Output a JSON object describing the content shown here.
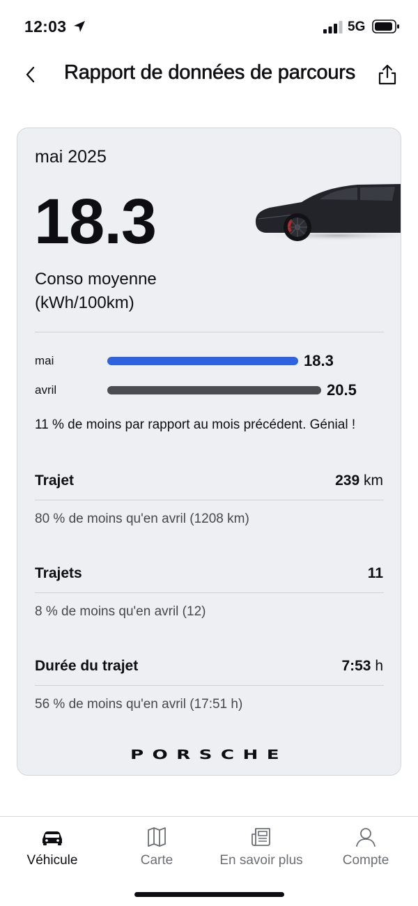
{
  "status_bar": {
    "time": "12:03",
    "location_icon": "location-arrow-icon",
    "signal_icon": "signal-bars-icon",
    "network": "5G",
    "battery_icon": "battery-icon"
  },
  "header": {
    "back_icon": "chevron-left-icon",
    "title": "Rapport de données de parcours",
    "share_icon": "share-icon"
  },
  "report": {
    "month": "mai 2025",
    "average_value": "18.3",
    "average_label_line1": "Conso moyenne",
    "average_label_line2": "(kWh/100km)",
    "comparison_bars": [
      {
        "label": "mai",
        "value": "18.3",
        "color": "#2e63e0",
        "amount": 18.3
      },
      {
        "label": "avril",
        "value": "20.5",
        "color": "#4a4c52",
        "amount": 20.5
      }
    ],
    "comparison_text": "11 % de moins par rapport au mois précédent. Génial !",
    "stats": [
      {
        "label": "Trajet",
        "value": "239",
        "unit": "km",
        "note": "80 % de moins qu'en avril (1208 km)"
      },
      {
        "label": "Trajets",
        "value": "11",
        "unit": "",
        "note": "8 % de moins qu'en avril (12)"
      },
      {
        "label": "Durée du trajet",
        "value": "7:53",
        "unit": "h",
        "note": "56 % de moins qu'en avril (17:51 h)"
      }
    ],
    "brand": "PORSCHE"
  },
  "bottom_nav": {
    "items": [
      {
        "label": "Véhicule",
        "icon": "car-icon",
        "active": true
      },
      {
        "label": "Carte",
        "icon": "map-icon",
        "active": false
      },
      {
        "label": "En savoir plus",
        "icon": "newspaper-icon",
        "active": false
      },
      {
        "label": "Compte",
        "icon": "user-icon",
        "active": false
      }
    ]
  }
}
